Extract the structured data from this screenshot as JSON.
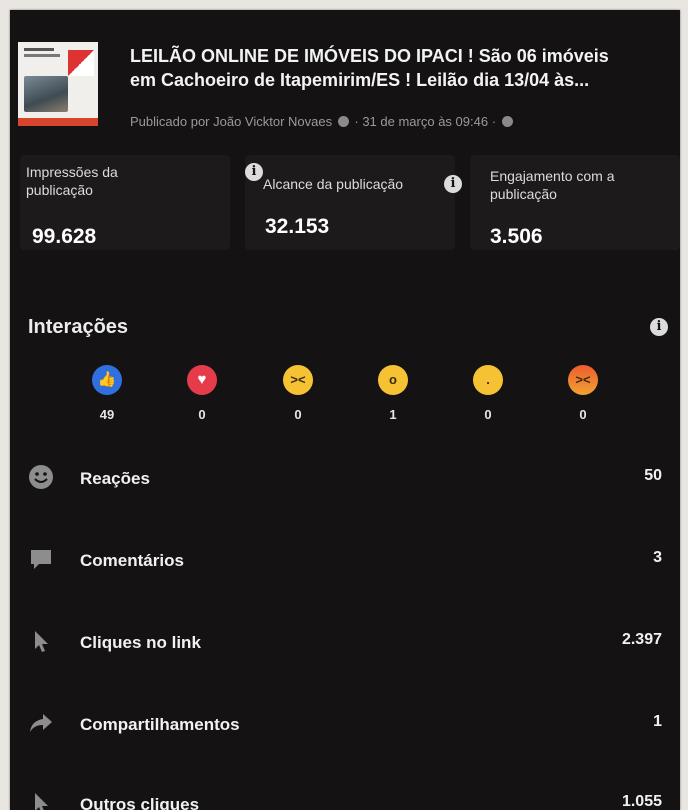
{
  "post": {
    "title_line1": "LEILÃO ONLINE DE IMÓVEIS DO IPACI ! São 06 imóveis",
    "title_line2": "em Cachoeiro de Itapemirim/ES ! Leilão dia 13/04 às...",
    "meta": "Publicado por João Vicktor Novaes",
    "date": "31 de março às 09:46"
  },
  "metrics": [
    {
      "label": "Impressões da publicação",
      "value": "99.628"
    },
    {
      "label": "Alcance da publicação",
      "value": "32.153"
    },
    {
      "label": "Engajamento com a publicação",
      "value": "3.506"
    }
  ],
  "interactions": {
    "title": "Interações",
    "reactions": [
      {
        "name": "like",
        "count": "49"
      },
      {
        "name": "love",
        "count": "0"
      },
      {
        "name": "haha",
        "count": "0"
      },
      {
        "name": "wow",
        "count": "1"
      },
      {
        "name": "sad",
        "count": "0"
      },
      {
        "name": "angry",
        "count": "0"
      }
    ]
  },
  "stats": [
    {
      "label": "Reações",
      "value": "50",
      "icon": "smiley-icon"
    },
    {
      "label": "Comentários",
      "value": "3",
      "icon": "comment-icon"
    },
    {
      "label": "Cliques no link",
      "value": "2.397",
      "icon": "cursor-icon"
    },
    {
      "label": "Compartilhamentos",
      "value": "1",
      "icon": "share-icon"
    },
    {
      "label": "Outros cliques",
      "value": "1.055",
      "icon": "cursor-icon"
    }
  ],
  "colors": {
    "background": "#141212",
    "card": "#1c1a1a",
    "like": "#2f6fe0",
    "love": "#e53b4b",
    "reaction_yellow": "#f6c233"
  }
}
